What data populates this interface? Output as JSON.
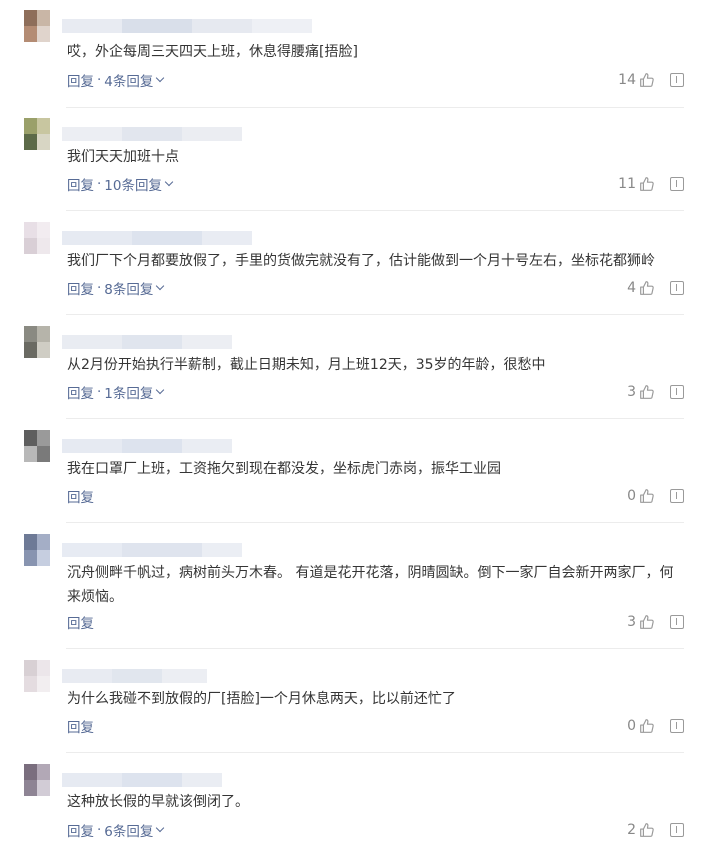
{
  "reply_label": "回复",
  "separator": "·",
  "comments": [
    {
      "text": "哎，外企每周三天四天上班，休息得腰痛[捂脸]",
      "more_replies": "4条回复",
      "likes": "14"
    },
    {
      "text": "我们天天加班十点",
      "more_replies": "10条回复",
      "likes": "11"
    },
    {
      "text": "我们厂下个月都要放假了，手里的货做完就没有了，估计能做到一个月十号左右，坐标花都狮岭",
      "more_replies": "8条回复",
      "likes": "4"
    },
    {
      "text": "从2月份开始执行半薪制，截止日期未知，月上班12天，35岁的年龄，很愁中",
      "more_replies": "1条回复",
      "likes": "3"
    },
    {
      "text": "我在口罩厂上班，工资拖欠到现在都没发，坐标虎门赤岗，振华工业园",
      "more_replies": "",
      "likes": "0"
    },
    {
      "text": "沉舟侧畔千帆过，病树前头万木春。 有道是花开花落，阴晴圆缺。倒下一家厂自会新开两家厂，何来烦恼。",
      "more_replies": "",
      "likes": "3"
    },
    {
      "text": "为什么我碰不到放假的厂[捂脸]一个月休息两天，比以前还忙了",
      "more_replies": "",
      "likes": "0"
    },
    {
      "text": "这种放长假的早就该倒闭了。",
      "more_replies": "6条回复",
      "likes": "2"
    }
  ]
}
